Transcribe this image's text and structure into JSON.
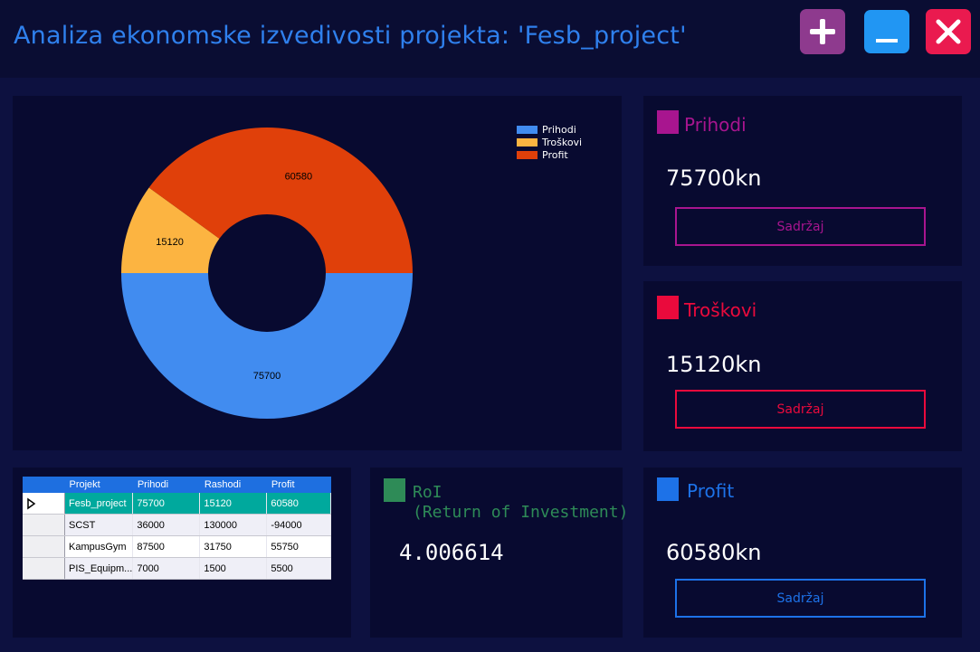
{
  "window": {
    "title": "Analiza ekonomske izvedivosti projekta: 'Fesb_project'",
    "buttons": {
      "add_icon": "plus-icon",
      "minimize_icon": "minimize-icon",
      "close_icon": "close-icon"
    }
  },
  "chart_data": {
    "type": "pie",
    "labels": [
      "Prihodi",
      "Troškovi",
      "Profit"
    ],
    "values": [
      75700,
      15120,
      60580
    ],
    "colors": [
      "#418cf0",
      "#fcb441",
      "#e0400a"
    ],
    "legend_position": "top-right",
    "donut": true
  },
  "cards": {
    "prihodi": {
      "label": "Prihodi",
      "value": "75700kn",
      "button": "Sadržaj",
      "color": "#a8158f"
    },
    "troskovi": {
      "label": "Troškovi",
      "value": "15120kn",
      "button": "Sadržaj",
      "color": "#ea0a3c"
    },
    "profit": {
      "label": "Profit",
      "value": "60580kn",
      "button": "Sadržaj",
      "color": "#1d72e8"
    }
  },
  "roi": {
    "label_line1": "RoI",
    "label_line2": "(Return of Investment)",
    "value": "4.006614",
    "color": "#2e8b57"
  },
  "grid": {
    "columns": [
      "Projekt",
      "Prihodi",
      "Rashodi",
      "Profit"
    ],
    "rows": [
      [
        "Fesb_project",
        "75700",
        "15120",
        "60580"
      ],
      [
        "SCST",
        "36000",
        "130000",
        "-94000"
      ],
      [
        "KampusGym",
        "87500",
        "31750",
        "55750"
      ],
      [
        "PIS_Equipm...",
        "7000",
        "1500",
        "5500"
      ]
    ],
    "selected_row": 0
  }
}
